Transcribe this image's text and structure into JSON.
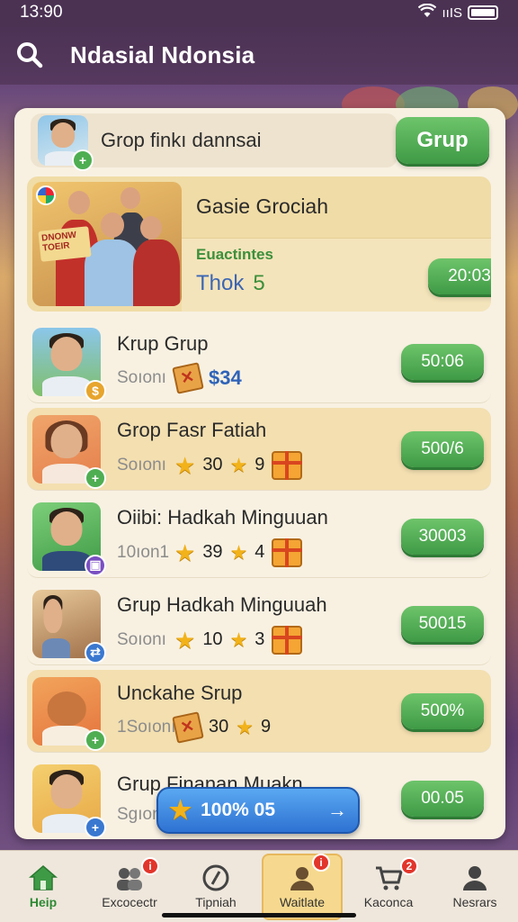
{
  "status": {
    "time": "13:90",
    "network": "ııIS"
  },
  "header": {
    "title": "Ndasial Ndonsia"
  },
  "group_search": {
    "text": "Grop finkı dannsai",
    "button": "Grup"
  },
  "featured": {
    "title": "Gasie Grociah",
    "subtitle": "Euactintes",
    "thok_label": "Thok",
    "thok_value": "5",
    "time": "20:03",
    "sign_text": "DNONW TOEIR"
  },
  "rows": [
    {
      "name": "Krup Grup",
      "sub": "Soıonı",
      "value1": "$34",
      "time": "50:06"
    },
    {
      "name": "Grop Fasr Fatiah",
      "sub": "Soıonı",
      "value1": "30",
      "value2": "9",
      "time": "500/6"
    },
    {
      "name": "Oiibi: Hadkah Minguuan",
      "sub": "10ıon1",
      "value1": "39",
      "value2": "4",
      "time": "30003"
    },
    {
      "name": "Grup Hadkah Minguuah",
      "sub": "Soıonı",
      "value1": "10",
      "value2": "3",
      "time": "50015"
    },
    {
      "name": "Unckahe Srup",
      "sub": "1Soıonı",
      "value1": "30",
      "value2": "9",
      "time": "500%"
    },
    {
      "name": "Grup Finanan Muakn",
      "sub": "Sgıon",
      "time": "00.05"
    }
  ],
  "promo": {
    "text": "100% 05",
    "arrow": "→"
  },
  "nav": [
    {
      "label": "Heip",
      "badge": ""
    },
    {
      "label": "Excocectr",
      "badge": "i"
    },
    {
      "label": "Tipniah",
      "badge": ""
    },
    {
      "label": "Waitlate",
      "badge": "i"
    },
    {
      "label": "Kaconca",
      "badge": "2"
    },
    {
      "label": "Nesrars",
      "badge": ""
    }
  ],
  "colors": {
    "accent_green": "#4fae52",
    "header_purple": "#4b3253",
    "panel_bg": "#f8f1e2",
    "promo_blue": "#3a83de"
  }
}
